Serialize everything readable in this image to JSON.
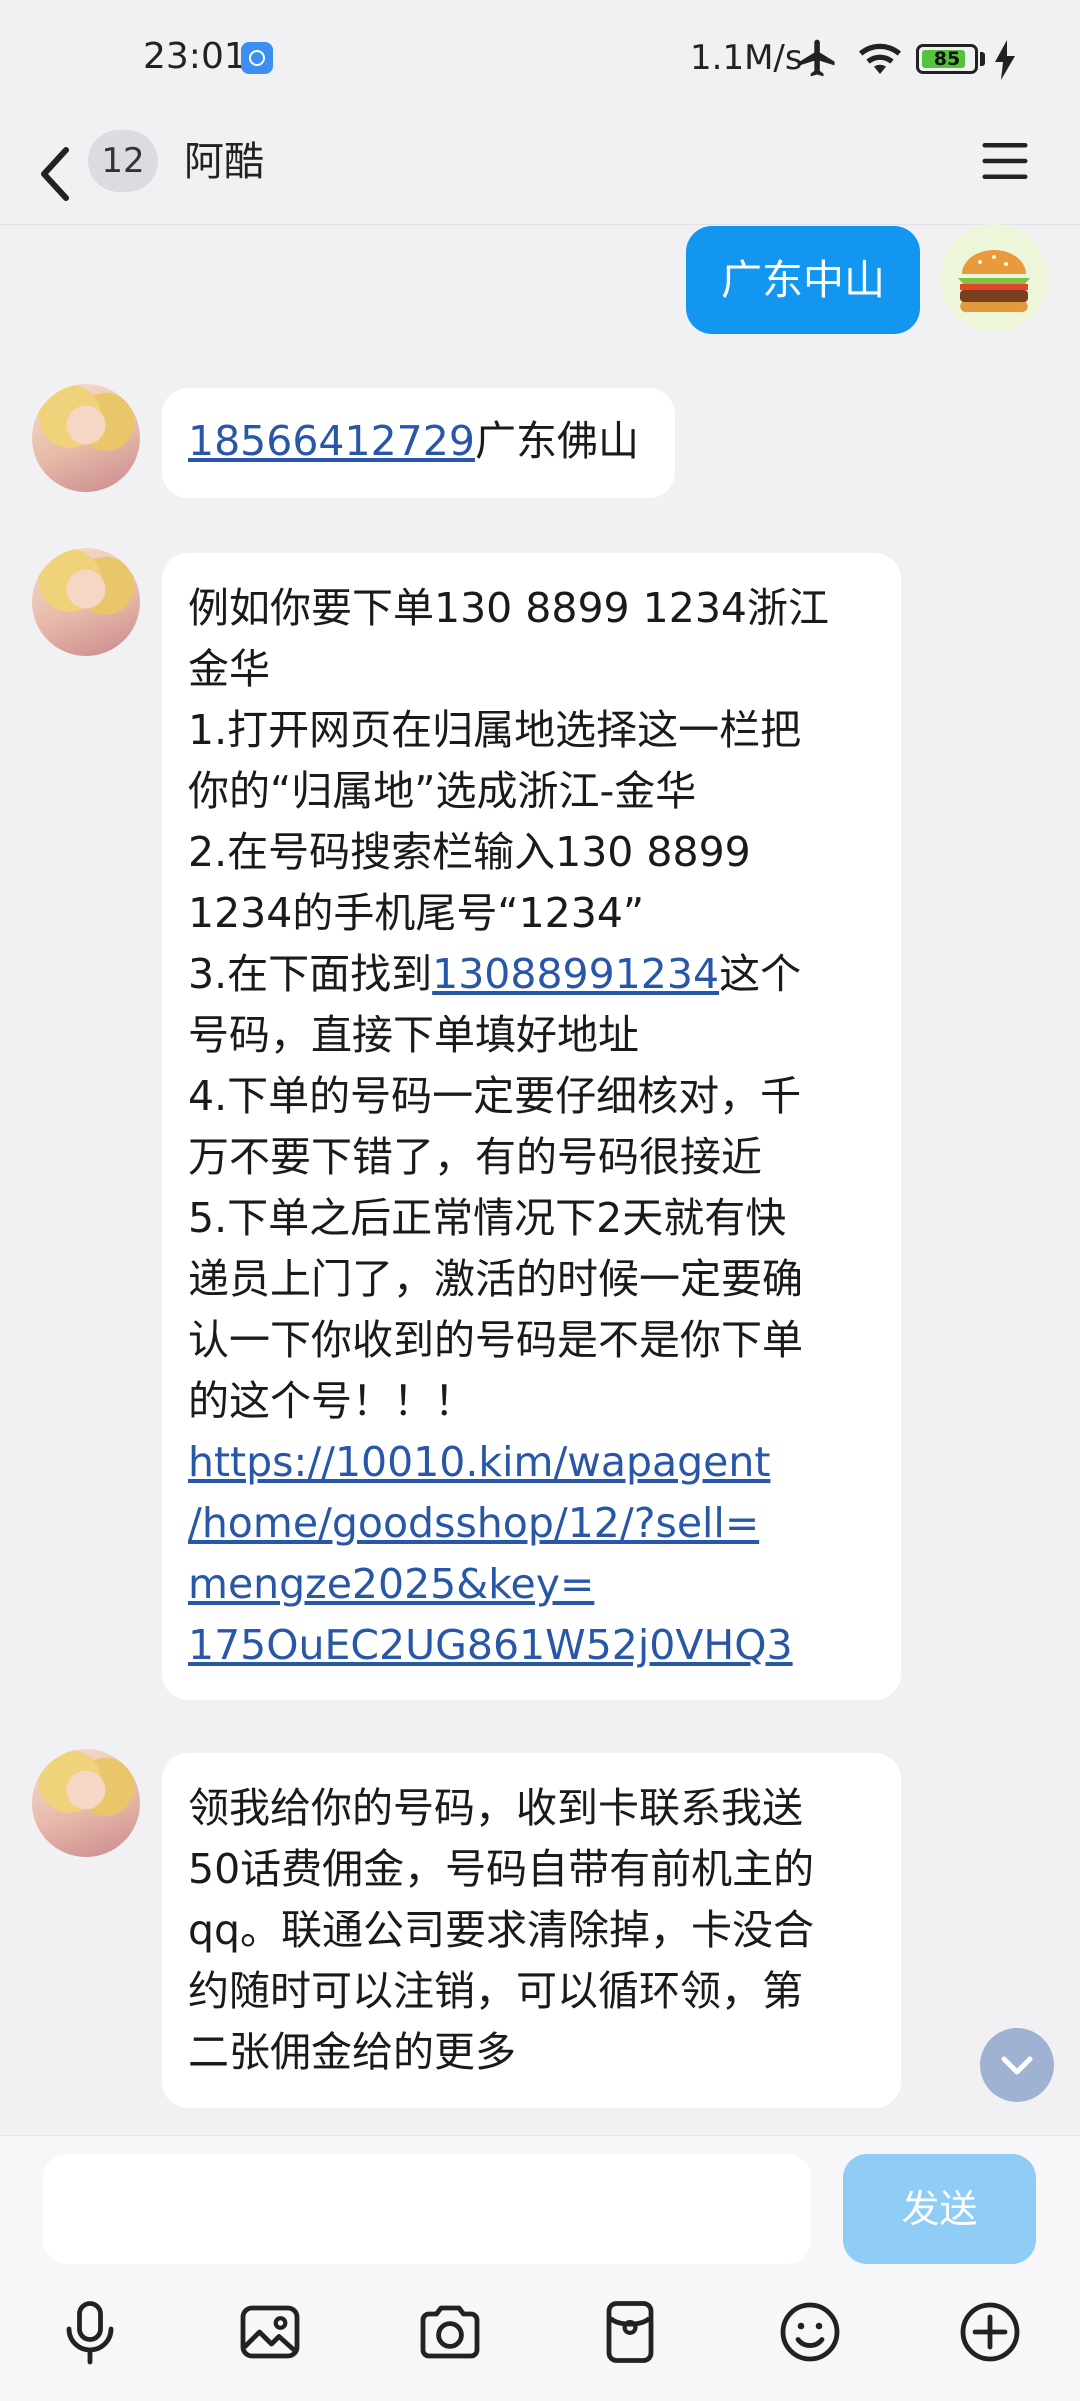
{
  "status_bar": {
    "time": "23:01",
    "net_speed": "1.1M/s",
    "battery_level": "85",
    "battery_fraction": 0.85
  },
  "header": {
    "unread_count": "12",
    "contact_name": "阿酷"
  },
  "messages": [
    {
      "direction": "out",
      "text": "广东中山"
    },
    {
      "direction": "in",
      "phone": "18566412729",
      "text": "广东佛山"
    },
    {
      "direction": "in",
      "lines": [
        "例如你要下单130 8899 1234浙江",
        "金华",
        "1.打开网页在归属地选择这一栏把",
        "你的“归属地”选成浙江-金华",
        "2.在号码搜索栏输入130 8899",
        "1234的手机尾号“1234”"
      ],
      "line7_prefix": "3.在下面找到",
      "line7_phone": "13088991234",
      "line7_suffix": "这个",
      "lines_after": [
        "号码，直接下单填好地址",
        "4.下单的号码一定要仔细核对，千",
        "万不要下错了，有的号码很接近",
        "5.下单之后正常情况下2天就有快",
        "递员上门了，激活的时候一定要确",
        "认一下你收到的号码是不是你下单",
        "的这个号！！！"
      ],
      "url_lines": [
        "https://10010.kim/wapagent",
        "/home/goodsshop/12/?sell=",
        "mengze2025&key=",
        "175OuEC2UG861W52j0VHQ3"
      ]
    },
    {
      "direction": "in",
      "lines": [
        "领我给你的号码，收到卡联系我送",
        "50话费佣金，号码自带有前机主的",
        "qq。联通公司要求清除掉，卡没合",
        "约随时可以注销，可以循环领，第",
        "二张佣金给的更多"
      ]
    }
  ],
  "input": {
    "placeholder": "",
    "send_label": "发送"
  },
  "toolbar_icons": [
    "microphone-icon",
    "image-icon",
    "camera-icon",
    "red-packet-icon",
    "emoji-icon",
    "plus-icon"
  ],
  "colors": {
    "accent": "#1296f0",
    "link": "#2857a8",
    "send_disabled": "#8fcdf7",
    "background": "#f1f1f4"
  }
}
